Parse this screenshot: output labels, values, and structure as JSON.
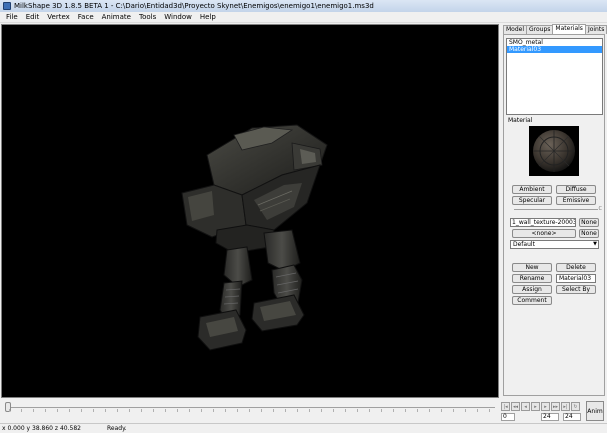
{
  "window": {
    "title": "MilkShape 3D 1.8.5 BETA 1 - C:\\Dario\\Entidad3d\\Proyecto Skynet\\Enemigos\\enemigo1\\enemigo1.ms3d"
  },
  "menu": {
    "items": [
      "File",
      "Edit",
      "Vertex",
      "Face",
      "Animate",
      "Tools",
      "Window",
      "Help"
    ]
  },
  "tabs": [
    "Model",
    "Groups",
    "Materials",
    "Joints"
  ],
  "active_tab": "Materials",
  "materials_panel": {
    "list": [
      "SMO_metal",
      "Material03"
    ],
    "selected": "Material03",
    "section_label": "Material",
    "ambient_label": "Ambient",
    "diffuse_label": "Diffuse",
    "specular_label": "Specular",
    "emissive_label": "Emissive",
    "slider_min": "",
    "slider_max": "C",
    "texture1": "1_wall_texture-200038-SI",
    "texture1_none": "None",
    "texture2": "<none>",
    "texture2_none": "None",
    "mode": "Default",
    "new_label": "New",
    "delete_label": "Delete",
    "rename_label": "Rename",
    "name_value": "Material03",
    "assign_label": "Assign",
    "select_by_label": "Select By",
    "comment_label": "Comment"
  },
  "animation": {
    "start_frame": "0",
    "current_frame": "24",
    "end_frame": "24",
    "anim_label": "Anim"
  },
  "status": {
    "coords": "x 0.000 y 38.860 z 40.582",
    "message": "Ready."
  }
}
